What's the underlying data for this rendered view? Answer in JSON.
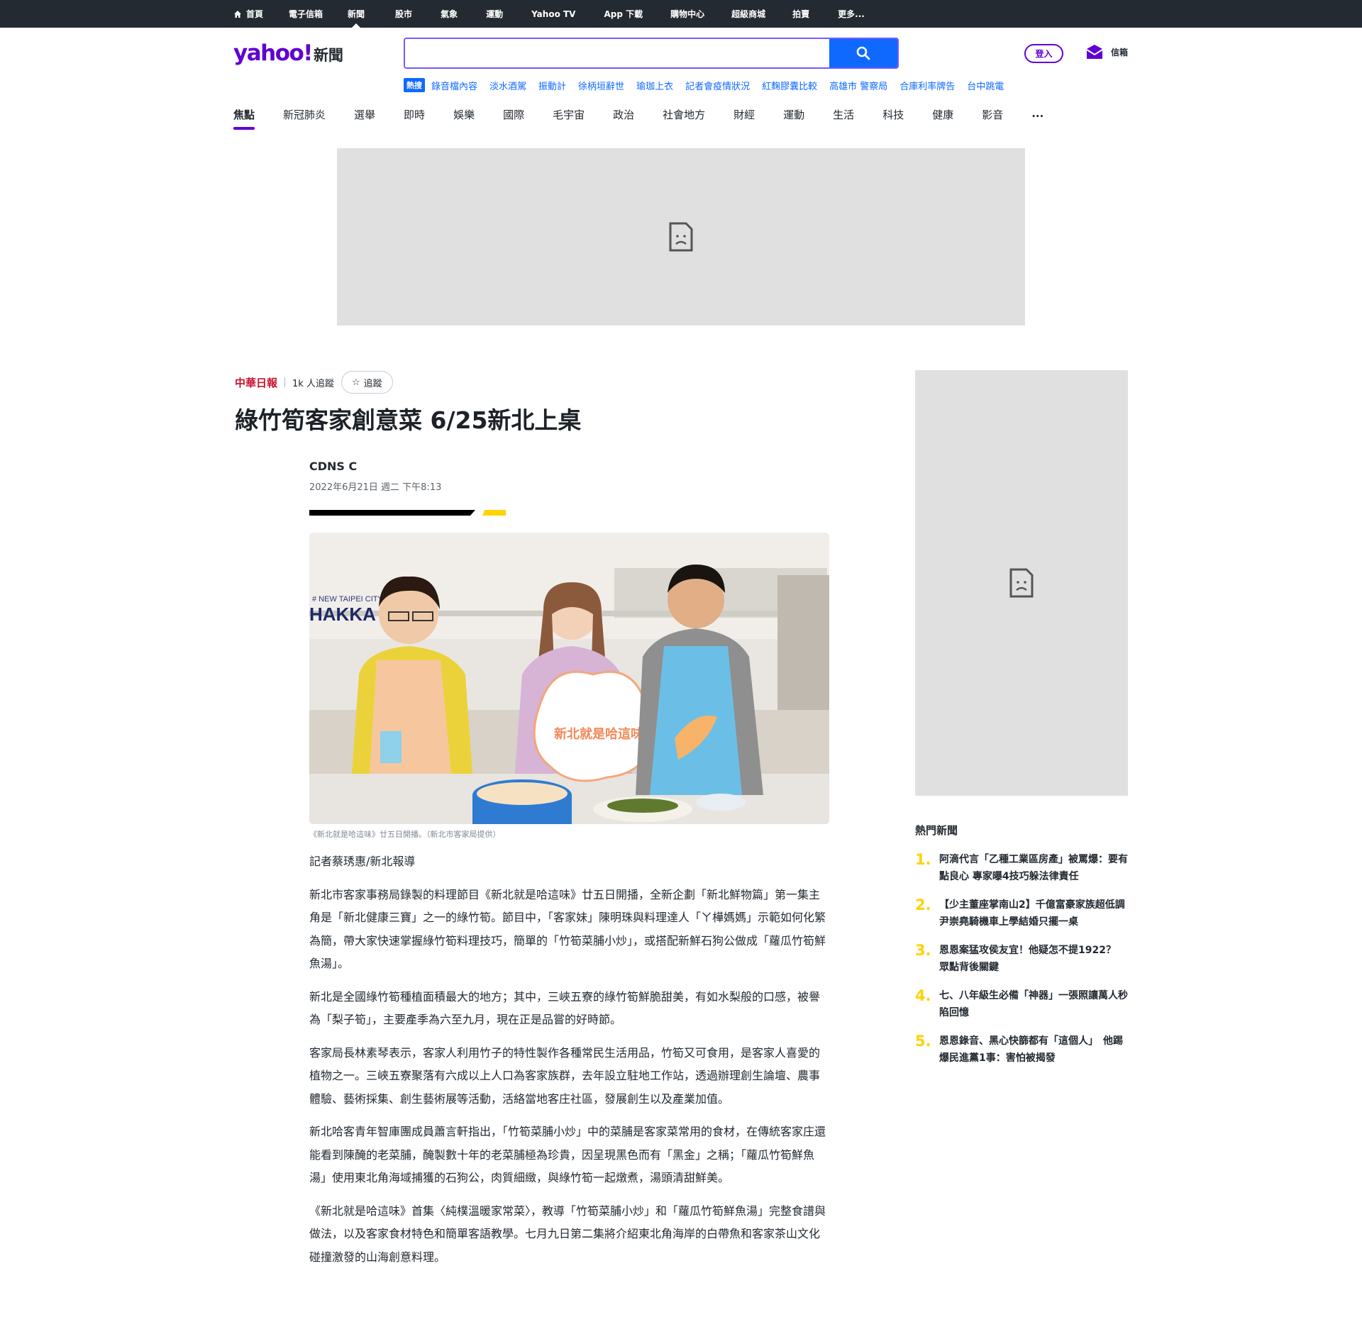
{
  "topnav": {
    "items": [
      "首頁",
      "電子信箱",
      "新聞",
      "股市",
      "氣象",
      "運動",
      "Yahoo TV",
      "App 下載",
      "購物中心",
      "超級商城",
      "拍賣",
      "更多..."
    ]
  },
  "header": {
    "logo_text": "yahoo!",
    "logo_section": "新聞",
    "search_placeholder": "",
    "login_label": "登入",
    "mail_label": "信箱"
  },
  "trending": {
    "tag": "熱搜",
    "items": [
      "錄音檔內容",
      "淡水酒駕",
      "振動計",
      "徐柄垣辭世",
      "瑜珈上衣",
      "記者會疫情狀況",
      "紅麴膠囊比較",
      "高雄市 警察局",
      "合庫利率牌告",
      "台中跳電"
    ]
  },
  "categories": [
    "焦點",
    "新冠肺炎",
    "選舉",
    "即時",
    "娛樂",
    "國際",
    "毛宇宙",
    "政治",
    "社會地方",
    "財經",
    "運動",
    "生活",
    "科技",
    "健康",
    "影音",
    "..."
  ],
  "article": {
    "publisher": "中華日報",
    "followers": "1k 人追蹤",
    "follow_label": "追蹤",
    "title": "綠竹筍客家創意菜 6/25新北上桌",
    "author": "CDNS C",
    "date": "2022年6月21日 週二 下午8:13",
    "photo_text_1": "HAKKA",
    "photo_text_2": "# NEW TAIPEI CITY",
    "photo_sign": "新北就是哈這味",
    "caption": "《新北就是哈這味》廿五日開播。（新北市客家局提供）",
    "paragraphs": [
      "記者蔡琇惠/新北報導",
      "新北市客家事務局錄製的料理節目《新北就是哈這味》廿五日開播，全新企劃「新北鮮物篇」第一集主角是「新北健康三寶」之一的綠竹筍。節目中，「客家妹」陳明珠與料理達人「ㄚ樺媽媽」示範如何化繁為簡，帶大家快速掌握綠竹筍料理技巧，簡單的「竹筍菜脯小炒」，或搭配新鮮石狗公做成「蘿瓜竹筍鮮魚湯」。",
      "新北是全國綠竹筍種植面積最大的地方；其中，三峽五寮的綠竹筍鮮脆甜美，有如水梨般的口感，被譽為「梨子筍」，主要產季為六至九月，現在正是品嘗的好時節。",
      "客家局長林素琴表示，客家人利用竹子的特性製作各種常民生活用品，竹筍又可食用，是客家人喜愛的植物之一。三峽五寮聚落有六成以上人口為客家族群，去年設立駐地工作站，透過辦理創生論壇、農事體驗、藝術採集、創生藝術展等活動，活絡當地客庄社區，發展創生以及產業加值。",
      "新北哈客青年智庫團成員蕭言軒指出，「竹筍菜脯小炒」中的菜脯是客家菜常用的食材，在傳統客家庄還能看到陳醃的老菜脯，醃製數十年的老菜脯極為珍貴，因呈現黑色而有「黑金」之稱；「蘿瓜竹筍鮮魚湯」使用東北角海域捕獲的石狗公，肉質細緻，與綠竹筍一起燉煮，湯頭清甜鮮美。",
      "《新北就是哈這味》首集〈純樸溫暖家常菜〉，教導「竹筍菜脯小炒」和「蘿瓜竹筍鮮魚湯」完整食譜與做法，以及客家食材特色和簡單客語教學。七月九日第二集將介紹東北角海岸的白帶魚和客家茶山文化碰撞激發的山海創意料理。"
    ]
  },
  "sidebar": {
    "hot_title": "熱門新聞",
    "hot_items": [
      {
        "num": "1.",
        "text": "阿滴代言「乙種工業區房產」被罵爆：要有點良心 專家曝4技巧躲法律責任"
      },
      {
        "num": "2.",
        "text": "【少主董座掌南山2】千億富豪家族超低調　尹崇堯騎機車上學結婚只擺一桌"
      },
      {
        "num": "3.",
        "text": "恩恩案猛攻侯友宜！他疑怎不提1922？　眾點背後關鍵"
      },
      {
        "num": "4.",
        "text": "七、八年級生必備「神器」一張照讓萬人秒陷回憶"
      },
      {
        "num": "5.",
        "text": "恩恩錄音、黑心快篩都有「這個人」　他踢爆民進黨1事：害怕被揭發"
      }
    ]
  },
  "colors": {
    "topbar": "#232a31",
    "brand": "#6001d2",
    "accent": "#0f69ff",
    "yellow": "#ffd200",
    "ad_bg": "#e0e0e0"
  }
}
